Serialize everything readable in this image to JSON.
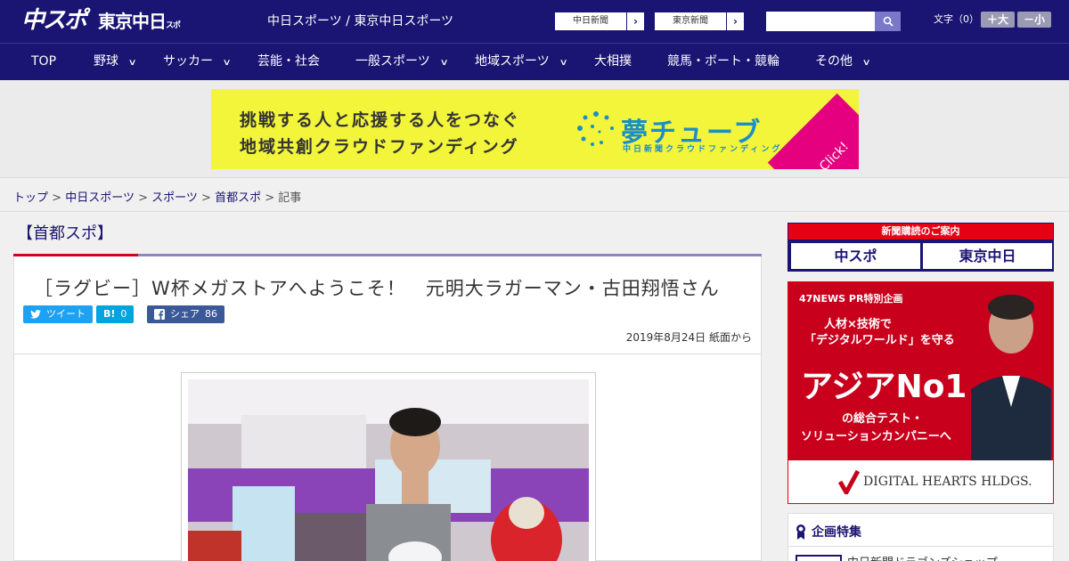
{
  "header": {
    "logo_chuspo": "中スポ",
    "logo_tokyo": "東京中日",
    "logo_tokyo_small": "スポーツ",
    "site_title": "中日スポーツ / 東京中日スポーツ",
    "paper_buttons": [
      "中日新聞",
      "東京新聞"
    ],
    "search_placeholder": "",
    "font_size_label": "文字（0）",
    "font_larger": "＋大",
    "font_smaller": "－小"
  },
  "nav": {
    "items": [
      {
        "label": "TOP",
        "has_menu": false
      },
      {
        "label": "野球",
        "has_menu": true
      },
      {
        "label": "サッカー",
        "has_menu": true
      },
      {
        "label": "芸能・社会",
        "has_menu": false
      },
      {
        "label": "一般スポーツ",
        "has_menu": true
      },
      {
        "label": "地域スポーツ",
        "has_menu": true
      },
      {
        "label": "大相撲",
        "has_menu": false
      },
      {
        "label": "競馬・ボート・競輪",
        "has_menu": false
      },
      {
        "label": "その他",
        "has_menu": true
      }
    ]
  },
  "banner": {
    "line1": "挑戦する人と応援する人をつなぐ",
    "line2": "地域共創クラウドファンディング",
    "brand": "夢チューブ",
    "sub": "中日新聞クラウドファンディング",
    "click": "Click!"
  },
  "breadcrumb": {
    "items": [
      "トップ",
      "中日スポーツ",
      "スポーツ",
      "首都スポ"
    ],
    "current": "記事",
    "separator": ">"
  },
  "article": {
    "section": "【首都スポ】",
    "headline": "［ラグビー］W杯メガストアへようこそ！　元明大ラガーマン・古田翔悟さん",
    "share": {
      "tweet": "ツイート",
      "hatena_label": "B!",
      "hatena_count": "0",
      "facebook": "シェア",
      "facebook_count": "86"
    },
    "dateline": "2019年8月24日 紙面から"
  },
  "sidebar": {
    "subscribe_head": "新聞購読のご案内",
    "subscribe_logos": [
      "中スポ",
      "東京中日"
    ],
    "ad": {
      "tag": "47NEWS PR特別企画",
      "line1": "人材×技術で",
      "line2": "「デジタルワールド」を守る",
      "big": "アジアNo1",
      "line3": "の総合テスト・",
      "line4": "ソリューションカンパニーへ",
      "brand": "DIGITAL HEARTS HLDGS."
    },
    "kikaku_head": "企画特集",
    "kikaku_item": "中日新聞ドラゴンズショップ"
  },
  "colors": {
    "navy": "#1a1472",
    "red": "#e60012",
    "banner_yellow": "#f2f53a",
    "brand_blue": "#1a8ec9",
    "twitter": "#1da1f2",
    "hatena": "#00a4de",
    "facebook": "#3b5998"
  }
}
